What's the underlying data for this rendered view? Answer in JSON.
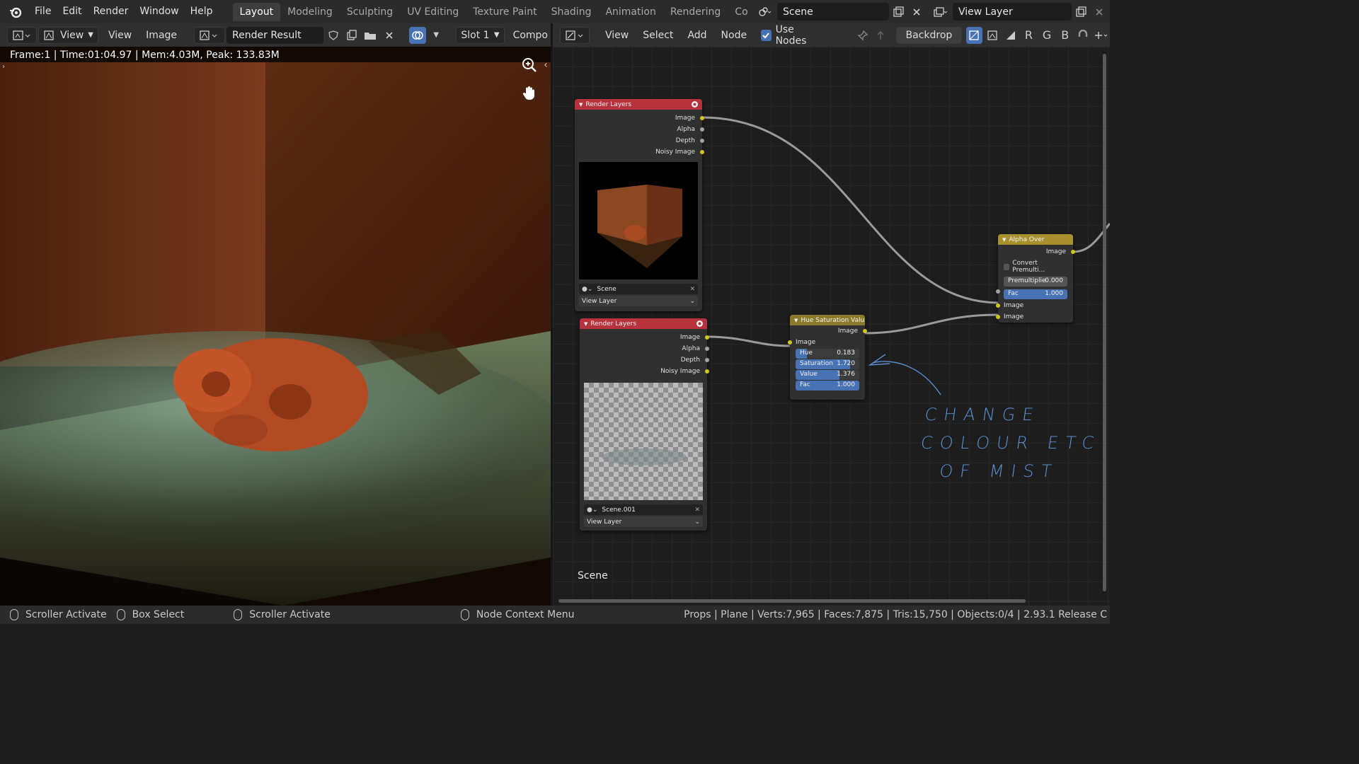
{
  "topbar": {
    "menus": [
      "File",
      "Edit",
      "Render",
      "Window",
      "Help"
    ],
    "workspaces": [
      "Layout",
      "Modeling",
      "Sculpting",
      "UV Editing",
      "Texture Paint",
      "Shading",
      "Animation",
      "Rendering",
      "Co"
    ],
    "active_workspace": "Layout",
    "scene_name": "Scene",
    "view_layer_name": "View Layer"
  },
  "image_editor": {
    "header": {
      "view_menu_1": "View",
      "view_menu_2": "View",
      "image_menu": "Image",
      "image_name": "Render Result",
      "slot": "Slot 1",
      "composite_label": "Compo"
    },
    "info_overlay": "Frame:1 | Time:01:04.97 | Mem:4.03M, Peak: 133.83M"
  },
  "node_editor": {
    "header": {
      "view": "View",
      "select": "Select",
      "add": "Add",
      "node": "Node",
      "use_nodes": "Use Nodes",
      "backdrop": "Backdrop",
      "channels": [
        "R",
        "G",
        "B"
      ]
    },
    "nodes": {
      "render_layers_1": {
        "title": "Render Layers",
        "outputs": [
          "Image",
          "Alpha",
          "Depth",
          "Noisy Image"
        ],
        "scene": "Scene",
        "view_layer": "View Layer"
      },
      "render_layers_2": {
        "title": "Render Layers",
        "outputs": [
          "Image",
          "Alpha",
          "Depth",
          "Noisy Image"
        ],
        "scene": "Scene.001",
        "view_layer": "View Layer"
      },
      "hue_saturation": {
        "title": "Hue Saturation Valu",
        "output": "Image",
        "input": "Image",
        "fields": [
          {
            "label": "Hue",
            "value": "0.183",
            "fill": 0.183
          },
          {
            "label": "Saturation",
            "value": "1.720",
            "fill": 0.86
          },
          {
            "label": "Value",
            "value": "1.376",
            "fill": 0.69
          },
          {
            "label": "Fac",
            "value": "1.000",
            "fill": 1.0
          }
        ]
      },
      "alpha_over": {
        "title": "Alpha Over",
        "output": "Image",
        "convert_premult": "Convert Premulti...",
        "premultiplied_label": "Premultiplie",
        "premultiplied_value": "0.000",
        "fac_label": "Fac",
        "fac_value": "1.000",
        "inputs": [
          "Image",
          "Image"
        ]
      }
    },
    "annotation_lines": [
      "CHANGE",
      "COLOUR ETC",
      "OF MIST"
    ],
    "scene_label": "Scene"
  },
  "statusbar": {
    "left": [
      "Scroller Activate",
      "Box Select",
      "Scroller Activate",
      "Node Context Menu"
    ],
    "right": "Props | Plane | Verts:7,965 | Faces:7,875 | Tris:15,750 | Objects:0/4 | 2.93.1 Release C"
  },
  "colors": {
    "accent": "#4772b3",
    "socket_yellow": "#cfc520",
    "render_layers_header": "#b8323e",
    "annotation": "#5b8fd1"
  }
}
